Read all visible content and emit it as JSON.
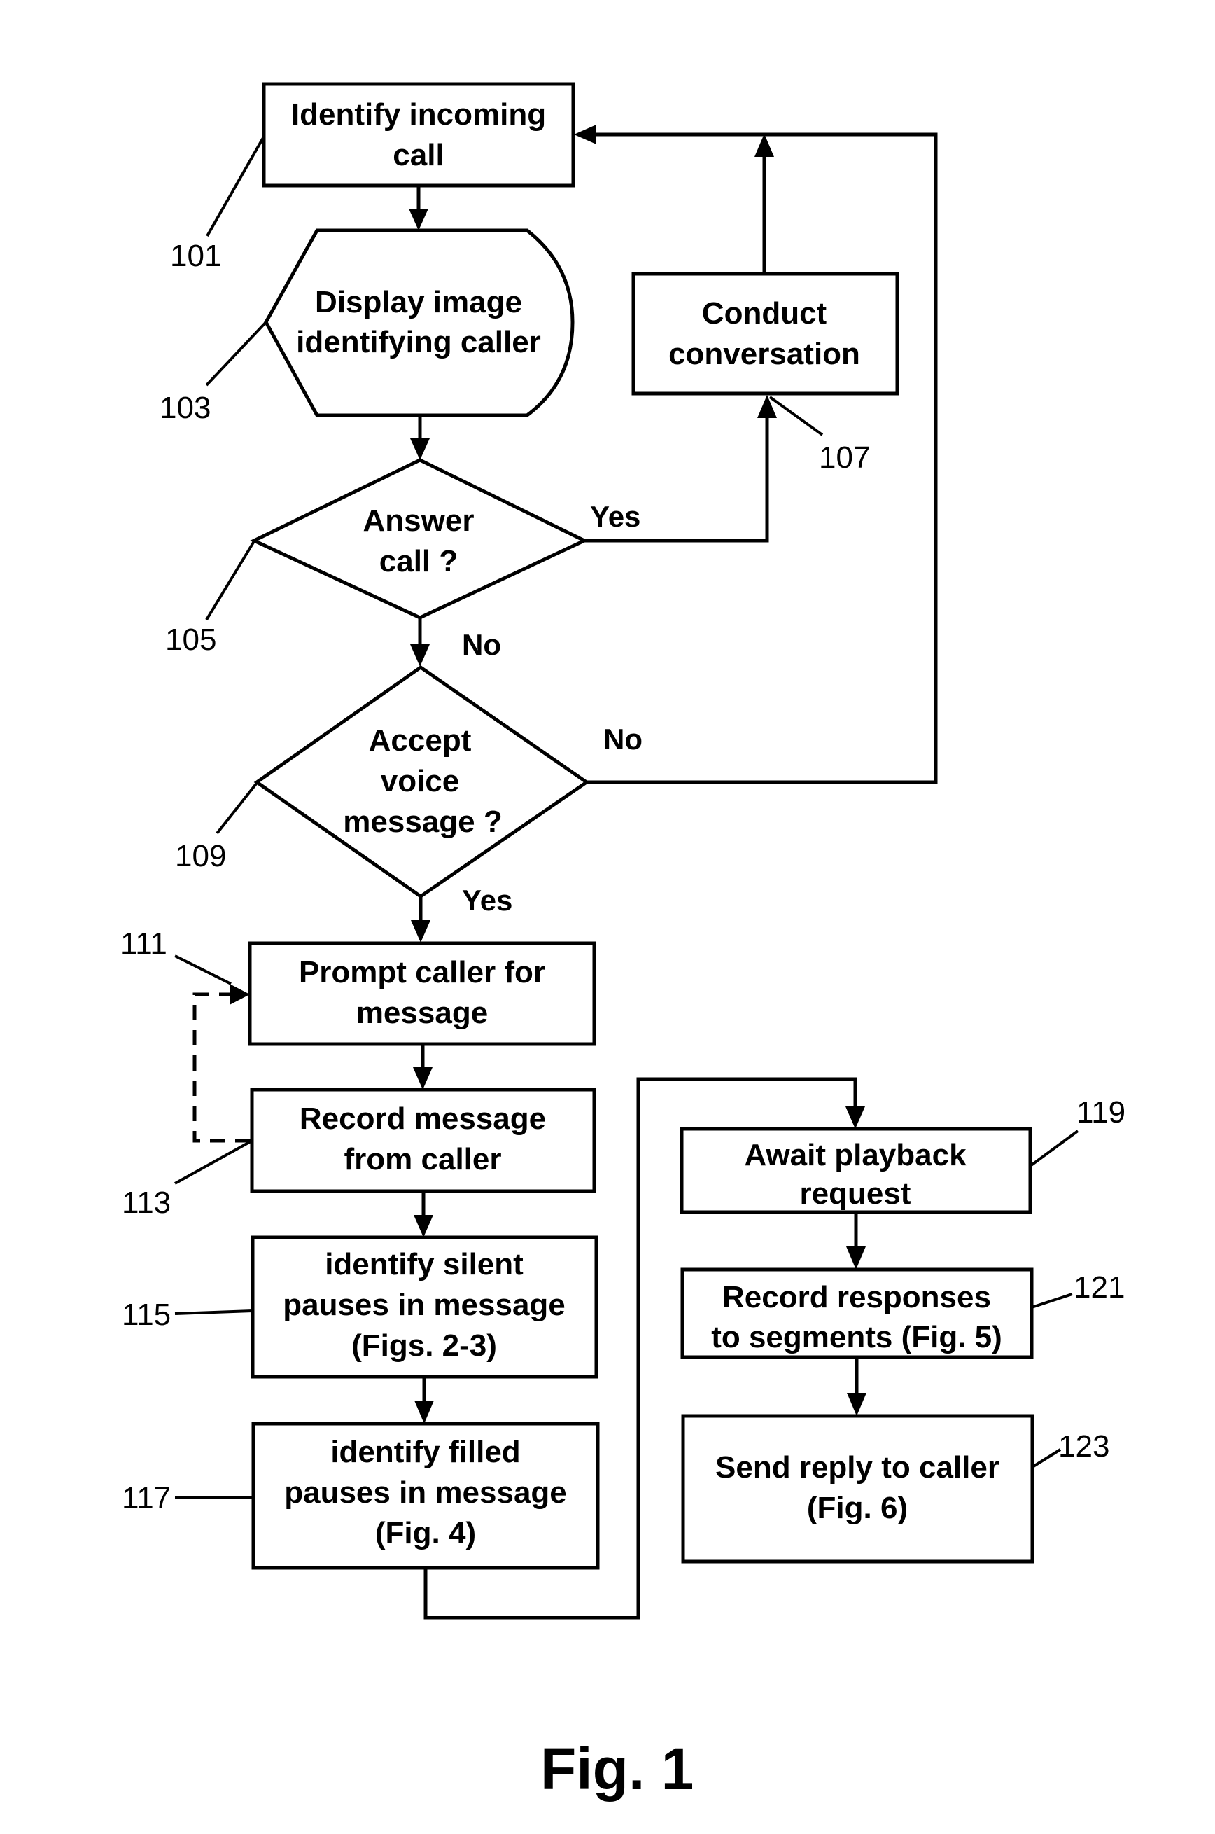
{
  "figure": {
    "caption": "Fig. 1"
  },
  "nodes": {
    "n101": {
      "ref": "101",
      "shape": "process",
      "lines": [
        "Identify incoming",
        "call"
      ]
    },
    "n103": {
      "ref": "103",
      "shape": "display",
      "lines": [
        "Display image",
        "identifying caller"
      ]
    },
    "n105": {
      "ref": "105",
      "shape": "decision",
      "lines": [
        "Answer",
        "call ?"
      ]
    },
    "n107": {
      "ref": "107",
      "shape": "process",
      "lines": [
        "Conduct",
        "conversation"
      ]
    },
    "n109": {
      "ref": "109",
      "shape": "decision",
      "lines": [
        "Accept",
        "voice",
        "message ?"
      ]
    },
    "n111": {
      "ref": "111",
      "shape": "process",
      "lines": [
        "Prompt caller for",
        "message"
      ]
    },
    "n113": {
      "ref": "113",
      "shape": "process",
      "lines": [
        "Record message",
        "from caller"
      ]
    },
    "n115": {
      "ref": "115",
      "shape": "process",
      "lines": [
        "identify silent",
        "pauses in message",
        "(Figs. 2-3)"
      ]
    },
    "n117": {
      "ref": "117",
      "shape": "process",
      "lines": [
        "identify filled",
        "pauses in message",
        "(Fig. 4)"
      ]
    },
    "n119": {
      "ref": "119",
      "shape": "process",
      "lines": [
        "Await playback",
        "request"
      ]
    },
    "n121": {
      "ref": "121",
      "shape": "process",
      "lines": [
        "Record responses",
        "to segments (Fig. 5)"
      ]
    },
    "n123": {
      "ref": "123",
      "shape": "process",
      "lines": [
        "Send reply to caller",
        "(Fig. 6)"
      ]
    }
  },
  "branches": {
    "answer_yes": "Yes",
    "answer_no": "No",
    "accept_no": "No",
    "accept_yes": "Yes"
  },
  "edges": [
    {
      "from": "101",
      "to": "103"
    },
    {
      "from": "103",
      "to": "105"
    },
    {
      "from": "105",
      "to": "107",
      "label": "Yes"
    },
    {
      "from": "105",
      "to": "109",
      "label": "No"
    },
    {
      "from": "107",
      "to": "101"
    },
    {
      "from": "109",
      "to": "101",
      "label": "No"
    },
    {
      "from": "109",
      "to": "111",
      "label": "Yes"
    },
    {
      "from": "111",
      "to": "113"
    },
    {
      "from": "113",
      "to": "111",
      "style": "dashed"
    },
    {
      "from": "113",
      "to": "115"
    },
    {
      "from": "115",
      "to": "117"
    },
    {
      "from": "117",
      "to": "119"
    },
    {
      "from": "119",
      "to": "121"
    },
    {
      "from": "121",
      "to": "123"
    }
  ]
}
